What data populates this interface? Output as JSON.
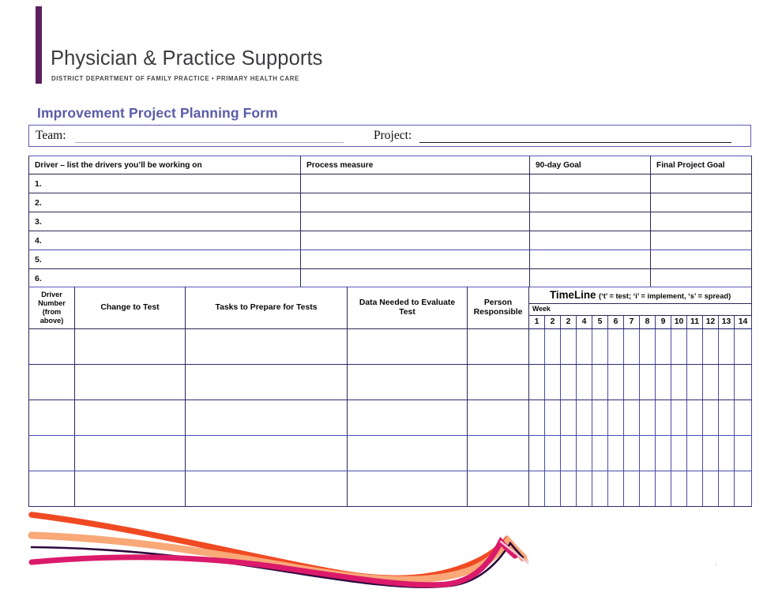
{
  "brand": {
    "name": "Physician & Practice Supports",
    "subtitle": "DISTRICT DEPARTMENT OF FAMILY PRACTICE  •  PRIMARY HEALTH CARE",
    "accent_bar_color": "#5b1f5e"
  },
  "form": {
    "title": "Improvement Project Planning Form",
    "title_color": "#5b5ba8"
  },
  "team_project": {
    "team_label": "Team:",
    "team_value": "",
    "project_label": "Project:",
    "project_value": ""
  },
  "driver_table": {
    "headers": [
      "Driver – list the drivers you’ll be working on",
      "Process measure",
      "90-day Goal",
      "Final Project Goal"
    ],
    "rows": [
      {
        "number": "1.",
        "process_measure": "",
        "goal_90day": "",
        "final_goal": ""
      },
      {
        "number": "2.",
        "process_measure": "",
        "goal_90day": "",
        "final_goal": ""
      },
      {
        "number": "3.",
        "process_measure": "",
        "goal_90day": "",
        "final_goal": ""
      },
      {
        "number": "4.",
        "process_measure": "",
        "goal_90day": "",
        "final_goal": ""
      },
      {
        "number": "5.",
        "process_measure": "",
        "goal_90day": "",
        "final_goal": ""
      },
      {
        "number": "6.",
        "process_measure": "",
        "goal_90day": "",
        "final_goal": ""
      }
    ]
  },
  "plan_table": {
    "headers": {
      "driver_number": "Driver Number (from above)",
      "driver_number_line1": "Driver",
      "driver_number_line2": "Number",
      "driver_number_line3": "(from",
      "driver_number_line4": "above)",
      "change_to_test": "Change to Test",
      "tasks": "Tasks to Prepare for Tests",
      "data_needed_line1": "Data Needed to Evaluate",
      "data_needed_line2": "Test",
      "person_line1": "Person",
      "person_line2": "Responsible",
      "timeline_main": "TimeLine",
      "timeline_legend": "(‘t’ = test; ‘i’ = implement, ‘s’ = spread)",
      "week": "Week"
    },
    "week_columns": [
      "1",
      "2",
      "2",
      "4",
      "5",
      "6",
      "7",
      "8",
      "9",
      "10",
      "11",
      "12",
      "13",
      "14"
    ],
    "body_rows": [
      {
        "driver_number": "",
        "change_to_test": "",
        "tasks": "",
        "data_needed": "",
        "person": ""
      },
      {
        "driver_number": "",
        "change_to_test": "",
        "tasks": "",
        "data_needed": "",
        "person": ""
      },
      {
        "driver_number": "",
        "change_to_test": "",
        "tasks": "",
        "data_needed": "",
        "person": ""
      },
      {
        "driver_number": "",
        "change_to_test": "",
        "tasks": "",
        "data_needed": "",
        "person": ""
      },
      {
        "driver_number": "",
        "change_to_test": "",
        "tasks": "",
        "data_needed": "",
        "person": ""
      }
    ]
  },
  "ribbon": {
    "colors": {
      "orange_red": "#f04a23",
      "peach": "#f9a878",
      "dark_purple": "#2b0a3d",
      "magenta": "#db1a6b"
    }
  },
  "palette": {
    "table_border": "#2a2a55",
    "table_accent_border": "#5a5ab4",
    "text": "#0a0a0a"
  }
}
